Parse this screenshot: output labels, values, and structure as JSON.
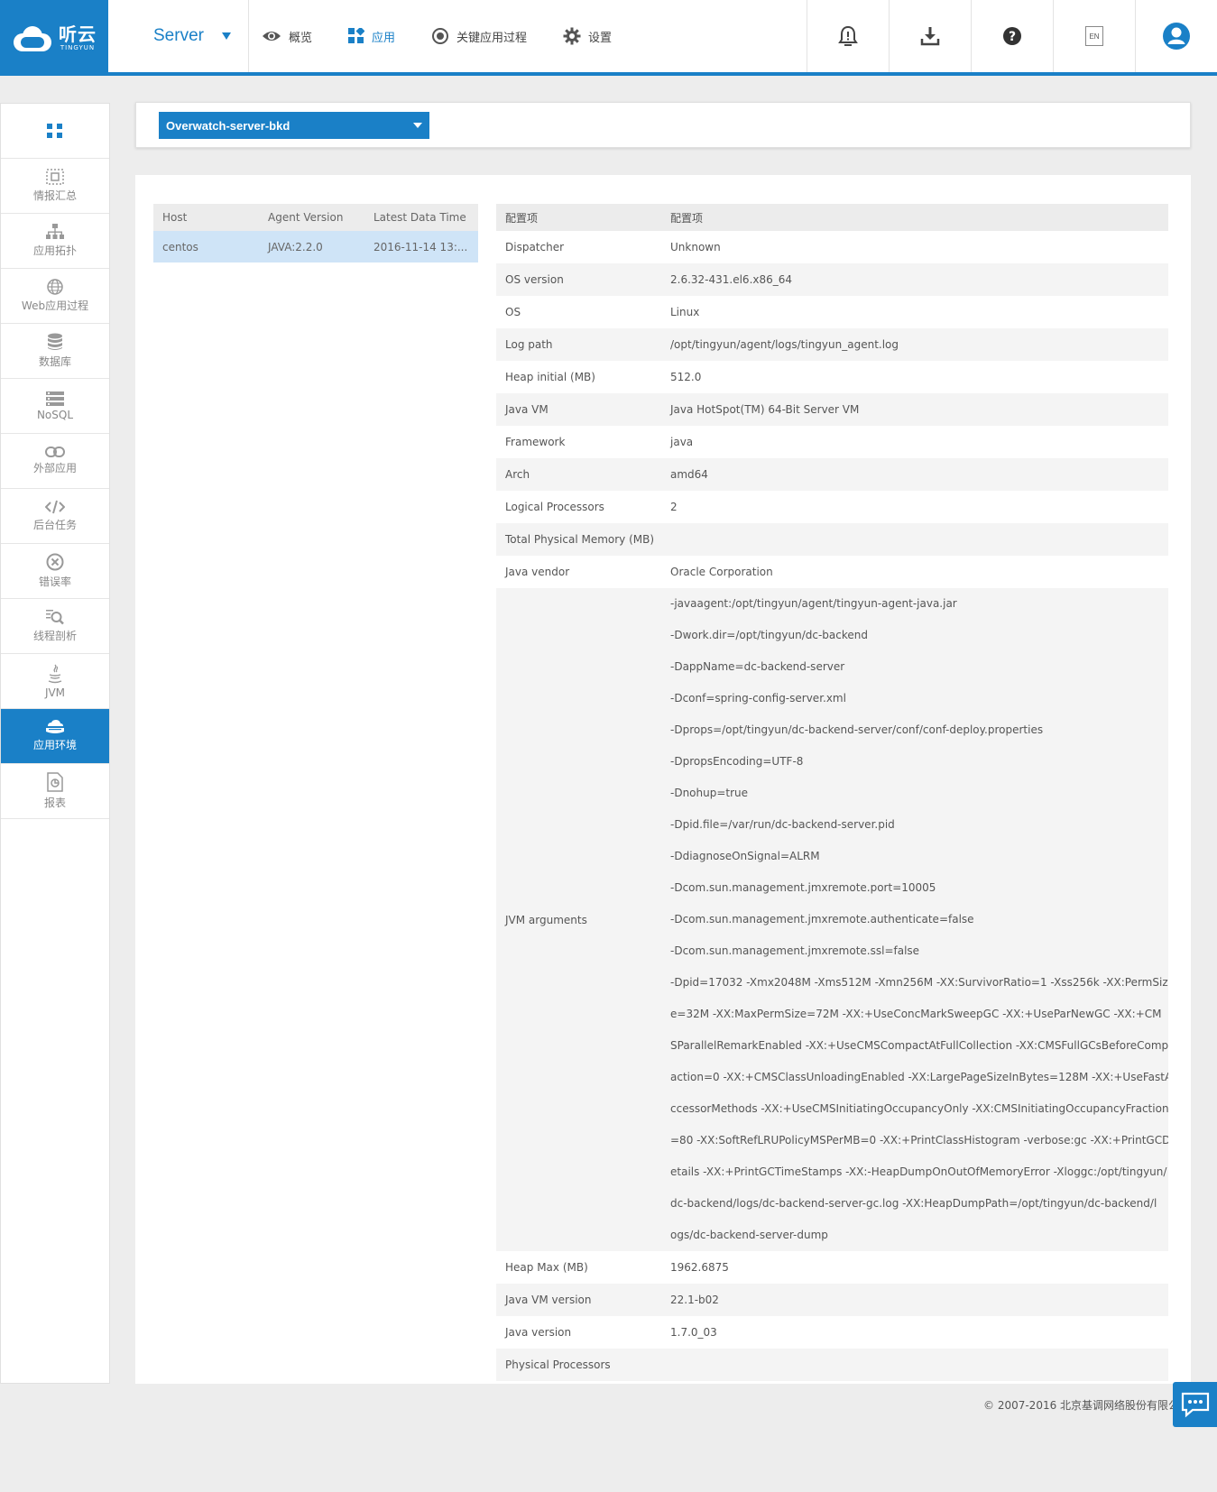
{
  "brand": {
    "name_cn": "听云",
    "name_en": "TINGYUN"
  },
  "header": {
    "product": "Server",
    "nav": [
      {
        "label": "概览",
        "icon": "eye-icon"
      },
      {
        "label": "应用",
        "icon": "apps-grid-icon",
        "active": true
      },
      {
        "label": "关键应用过程",
        "icon": "target-icon"
      },
      {
        "label": "设置",
        "icon": "gear-icon"
      }
    ],
    "lang": "EN"
  },
  "sidebar": {
    "items": [
      {
        "label": "情报汇总",
        "icon": "summary-icon"
      },
      {
        "label": "应用拓扑",
        "icon": "topology-icon"
      },
      {
        "label": "Web应用过程",
        "icon": "globe-icon"
      },
      {
        "label": "数据库",
        "icon": "database-icon"
      },
      {
        "label": "NoSQL",
        "icon": "nosql-icon"
      },
      {
        "label": "外部应用",
        "icon": "link-icon"
      },
      {
        "label": "后台任务",
        "icon": "code-icon"
      },
      {
        "label": "错误率",
        "icon": "error-icon"
      },
      {
        "label": "线程剖析",
        "icon": "thread-profile-icon"
      },
      {
        "label": "JVM",
        "icon": "java-icon"
      },
      {
        "label": "应用环境",
        "icon": "environment-icon",
        "active": true
      },
      {
        "label": "报表",
        "icon": "report-icon"
      }
    ]
  },
  "app_selector": {
    "value": "Overwatch-server-bkd"
  },
  "host_table": {
    "headers": [
      "Host",
      "Agent Version",
      "Latest Data Time"
    ],
    "rows": [
      {
        "host": "centos",
        "agent_version": "JAVA:2.2.0",
        "latest_data_time": "2016-11-14 13:..."
      }
    ]
  },
  "config_table": {
    "headers": [
      "配置项",
      "配置项"
    ],
    "rows": [
      {
        "key": "Dispatcher",
        "value": "Unknown"
      },
      {
        "key": "OS version",
        "value": "2.6.32-431.el6.x86_64"
      },
      {
        "key": "OS",
        "value": "Linux"
      },
      {
        "key": "Log path",
        "value": "/opt/tingyun/agent/logs/tingyun_agent.log"
      },
      {
        "key": "Heap initial (MB)",
        "value": "512.0"
      },
      {
        "key": "Java VM",
        "value": "Java HotSpot(TM) 64-Bit Server VM"
      },
      {
        "key": "Framework",
        "value": "java"
      },
      {
        "key": "Arch",
        "value": "amd64"
      },
      {
        "key": "Logical Processors",
        "value": "2"
      },
      {
        "key": "Total Physical Memory (MB)",
        "value": ""
      },
      {
        "key": "Java vendor",
        "value": "Oracle Corporation"
      }
    ],
    "jvm_key": "JVM arguments",
    "jvm_lines": [
      "-javaagent:/opt/tingyun/agent/tingyun-agent-java.jar",
      "-Dwork.dir=/opt/tingyun/dc-backend",
      "-DappName=dc-backend-server",
      "-Dconf=spring-config-server.xml",
      "-Dprops=/opt/tingyun/dc-backend-server/conf/conf-deploy.properties",
      "-DpropsEncoding=UTF-8",
      "-Dnohup=true",
      "-Dpid.file=/var/run/dc-backend-server.pid",
      "-DdiagnoseOnSignal=ALRM",
      "-Dcom.sun.management.jmxremote.port=10005",
      "-Dcom.sun.management.jmxremote.authenticate=false",
      "-Dcom.sun.management.jmxremote.ssl=false",
      "-Dpid=17032 -Xmx2048M -Xms512M -Xmn256M -XX:SurvivorRatio=1 -Xss256k -XX:PermSiz",
      "e=32M -XX:MaxPermSize=72M -XX:+UseConcMarkSweepGC -XX:+UseParNewGC -XX:+CM",
      "SParallelRemarkEnabled -XX:+UseCMSCompactAtFullCollection -XX:CMSFullGCsBeforeComp",
      "action=0 -XX:+CMSClassUnloadingEnabled -XX:LargePageSizeInBytes=128M -XX:+UseFastA",
      "ccessorMethods -XX:+UseCMSInitiatingOccupancyOnly -XX:CMSInitiatingOccupancyFraction",
      "=80 -XX:SoftRefLRUPolicyMSPerMB=0 -XX:+PrintClassHistogram -verbose:gc -XX:+PrintGCD",
      "etails -XX:+PrintGCTimeStamps -XX:-HeapDumpOnOutOfMemoryError -Xloggc:/opt/tingyun/",
      "dc-backend/logs/dc-backend-server-gc.log -XX:HeapDumpPath=/opt/tingyun/dc-backend/l",
      "ogs/dc-backend-server-dump"
    ],
    "rows_after": [
      {
        "key": "Heap Max (MB)",
        "value": "1962.6875"
      },
      {
        "key": "Java VM version",
        "value": "22.1-b02"
      },
      {
        "key": "Java version",
        "value": "1.7.0_03"
      },
      {
        "key": "Physical Processors",
        "value": ""
      }
    ]
  },
  "footer": {
    "text": "© 2007-2016  北京基调网络股份有限公"
  },
  "colors": {
    "primary": "#1a80c7",
    "selected_row": "#cfe4f7",
    "header_bg": "#ececec"
  }
}
